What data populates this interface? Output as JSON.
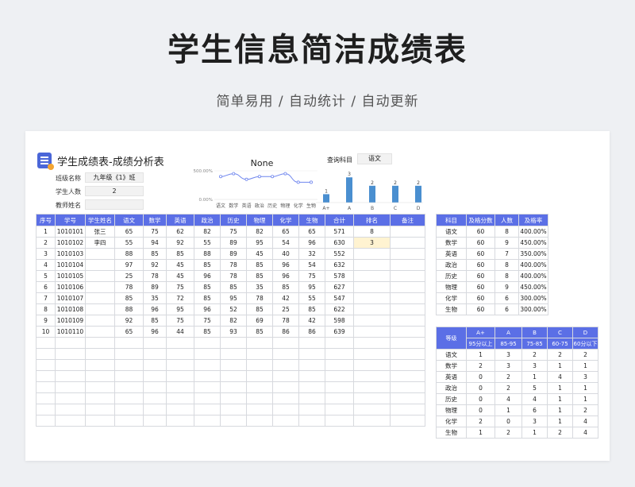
{
  "hero": {
    "title": "学生信息简洁成绩表",
    "subtitle": "简单易用 / 自动统计 / 自动更新"
  },
  "sheet": {
    "title": "学生成绩表-成绩分析表",
    "info": [
      {
        "label": "班级名称",
        "value": "九年级《1》班"
      },
      {
        "label": "学生人数",
        "value": "2"
      },
      {
        "label": "教师姓名",
        "value": ""
      }
    ],
    "query": {
      "label": "查询科目",
      "value": "语文"
    }
  },
  "colors": {
    "accent": "#5b6fe6",
    "bar": "#4a8fd0",
    "line": "#6f86ee",
    "highlight": "#fff3d1"
  },
  "chart_data": [
    {
      "type": "line",
      "title": "None",
      "categories": [
        "语文",
        "数学",
        "英语",
        "政治",
        "历史",
        "物理",
        "化学",
        "生物"
      ],
      "values": [
        400,
        450,
        350,
        400,
        400,
        450,
        300,
        300
      ],
      "ylim": [
        0,
        500
      ],
      "yticks": [
        "500.00%",
        "0.00%"
      ]
    },
    {
      "type": "bar",
      "categories": [
        "A+",
        "A",
        "B",
        "C",
        "D"
      ],
      "values": [
        1,
        3,
        2,
        2,
        2
      ],
      "ylim": [
        0,
        3.4
      ]
    }
  ],
  "main_table": {
    "headers": [
      "序号",
      "学号",
      "学生姓名",
      "语文",
      "数学",
      "英语",
      "政治",
      "历史",
      "物理",
      "化学",
      "生物",
      "合计",
      "排名",
      "备注"
    ],
    "rows": [
      [
        "1",
        "1010101",
        "张三",
        "65",
        "75",
        "62",
        "82",
        "75",
        "82",
        "65",
        "65",
        "571",
        "8",
        ""
      ],
      [
        "2",
        "1010102",
        "李四",
        "55",
        "94",
        "92",
        "55",
        "89",
        "95",
        "54",
        "96",
        "630",
        "3",
        ""
      ],
      [
        "3",
        "1010103",
        "",
        "88",
        "85",
        "85",
        "88",
        "89",
        "45",
        "40",
        "32",
        "552",
        "",
        ""
      ],
      [
        "4",
        "1010104",
        "",
        "97",
        "92",
        "45",
        "85",
        "78",
        "85",
        "96",
        "54",
        "632",
        "",
        ""
      ],
      [
        "5",
        "1010105",
        "",
        "25",
        "78",
        "45",
        "96",
        "78",
        "85",
        "96",
        "75",
        "578",
        "",
        ""
      ],
      [
        "6",
        "1010106",
        "",
        "78",
        "89",
        "75",
        "85",
        "85",
        "35",
        "85",
        "95",
        "627",
        "",
        ""
      ],
      [
        "7",
        "1010107",
        "",
        "85",
        "35",
        "72",
        "85",
        "95",
        "78",
        "42",
        "55",
        "547",
        "",
        ""
      ],
      [
        "8",
        "1010108",
        "",
        "88",
        "96",
        "95",
        "96",
        "52",
        "85",
        "25",
        "85",
        "622",
        "",
        ""
      ],
      [
        "9",
        "1010109",
        "",
        "92",
        "85",
        "75",
        "75",
        "82",
        "69",
        "78",
        "42",
        "598",
        "",
        ""
      ],
      [
        "10",
        "1010110",
        "",
        "65",
        "96",
        "44",
        "85",
        "93",
        "85",
        "86",
        "86",
        "639",
        "",
        ""
      ]
    ]
  },
  "subject_table": {
    "headers": [
      "科目",
      "及格分数",
      "人数",
      "及格率"
    ],
    "rows": [
      [
        "语文",
        "60",
        "8",
        "400.00%"
      ],
      [
        "数学",
        "60",
        "9",
        "450.00%"
      ],
      [
        "英语",
        "60",
        "7",
        "350.00%"
      ],
      [
        "政治",
        "60",
        "8",
        "400.00%"
      ],
      [
        "历史",
        "60",
        "8",
        "400.00%"
      ],
      [
        "物理",
        "60",
        "9",
        "450.00%"
      ],
      [
        "化学",
        "60",
        "6",
        "300.00%"
      ],
      [
        "生物",
        "60",
        "6",
        "300.00%"
      ]
    ]
  },
  "grade_table": {
    "header_top": [
      "等级",
      "A+",
      "A",
      "B",
      "C",
      "D"
    ],
    "header_sub": [
      "95分以上",
      "85-95",
      "75-85",
      "60-75",
      "60分以下"
    ],
    "rows": [
      [
        "语文",
        "1",
        "3",
        "2",
        "2",
        "2"
      ],
      [
        "数学",
        "2",
        "3",
        "3",
        "1",
        "1"
      ],
      [
        "英语",
        "0",
        "2",
        "1",
        "4",
        "3"
      ],
      [
        "政治",
        "0",
        "2",
        "5",
        "1",
        "1"
      ],
      [
        "历史",
        "0",
        "4",
        "4",
        "1",
        "1"
      ],
      [
        "物理",
        "0",
        "1",
        "6",
        "1",
        "2"
      ],
      [
        "化学",
        "2",
        "0",
        "3",
        "1",
        "4"
      ],
      [
        "生物",
        "1",
        "2",
        "1",
        "2",
        "4"
      ]
    ]
  }
}
